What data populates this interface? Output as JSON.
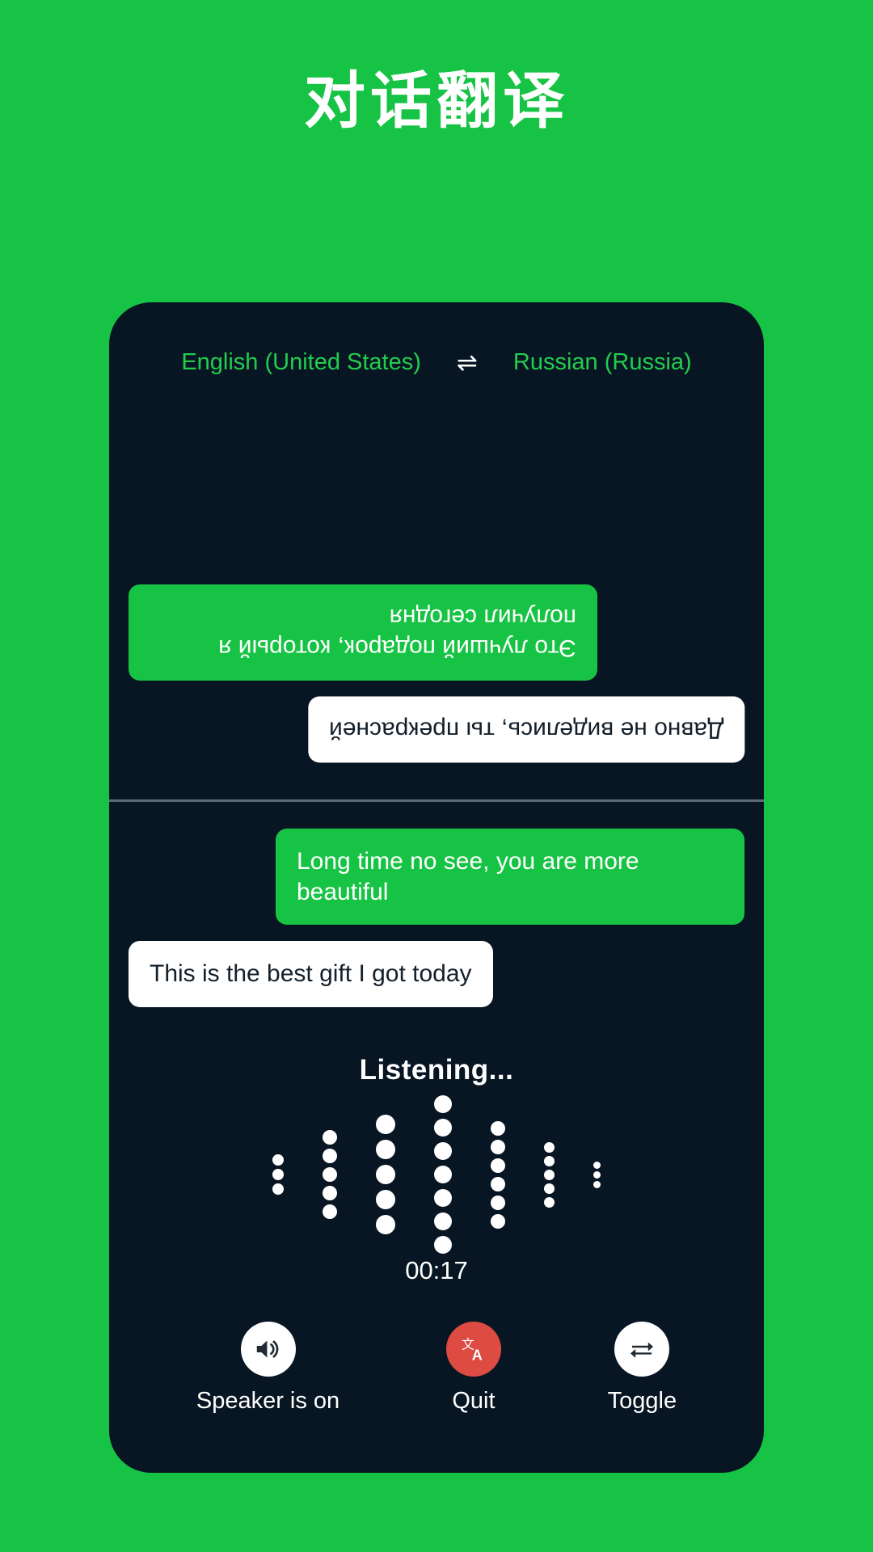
{
  "page": {
    "title": "对话翻译",
    "background_color": "#17c344",
    "card_color": "#081623"
  },
  "card": {
    "language_bar": {
      "source_language": "English (United States)",
      "swap_icon": "swap-horizontal-arrows-icon",
      "swap_glyph": "⇌",
      "target_language": "Russian (Russia)",
      "text_color": "#21ce4e"
    },
    "conversation": {
      "top_panel": {
        "orientation": "rotated-180",
        "messages": [
          {
            "text": "Это лучший подарок, который я получил сегодня",
            "style": "green",
            "align": "left"
          },
          {
            "text": "Давно не виделись, ты прекрасней",
            "style": "white",
            "align": "right"
          }
        ]
      },
      "bottom_panel": {
        "orientation": "normal",
        "messages": [
          {
            "text": "Long time no see, you are more beautiful",
            "style": "green",
            "align": "right"
          },
          {
            "text": "This is the best gift I got today",
            "style": "white",
            "align": "left"
          }
        ]
      }
    },
    "listening": {
      "status_label": "Listening...",
      "timer": "00:17",
      "waveform": {
        "columns": [
          {
            "dots": 3,
            "size": 14
          },
          {
            "dots": 5,
            "size": 18
          },
          {
            "dots": 5,
            "size": 24
          },
          {
            "dots": 7,
            "size": 22
          },
          {
            "dots": 6,
            "size": 18
          },
          {
            "dots": 5,
            "size": 13
          },
          {
            "dots": 3,
            "size": 9
          }
        ],
        "dot_color": "#ffffff"
      }
    },
    "controls": [
      {
        "label": "Speaker is on",
        "icon": "speaker-on-icon",
        "circle_color": "#ffffff",
        "icon_color": "#222b33"
      },
      {
        "label": "Quit",
        "icon": "translate-icon",
        "circle_color": "#de4b42",
        "icon_color": "#ffffff"
      },
      {
        "label": "Toggle",
        "icon": "swap-repeat-icon",
        "circle_color": "#ffffff",
        "icon_color": "#222b33"
      }
    ]
  }
}
